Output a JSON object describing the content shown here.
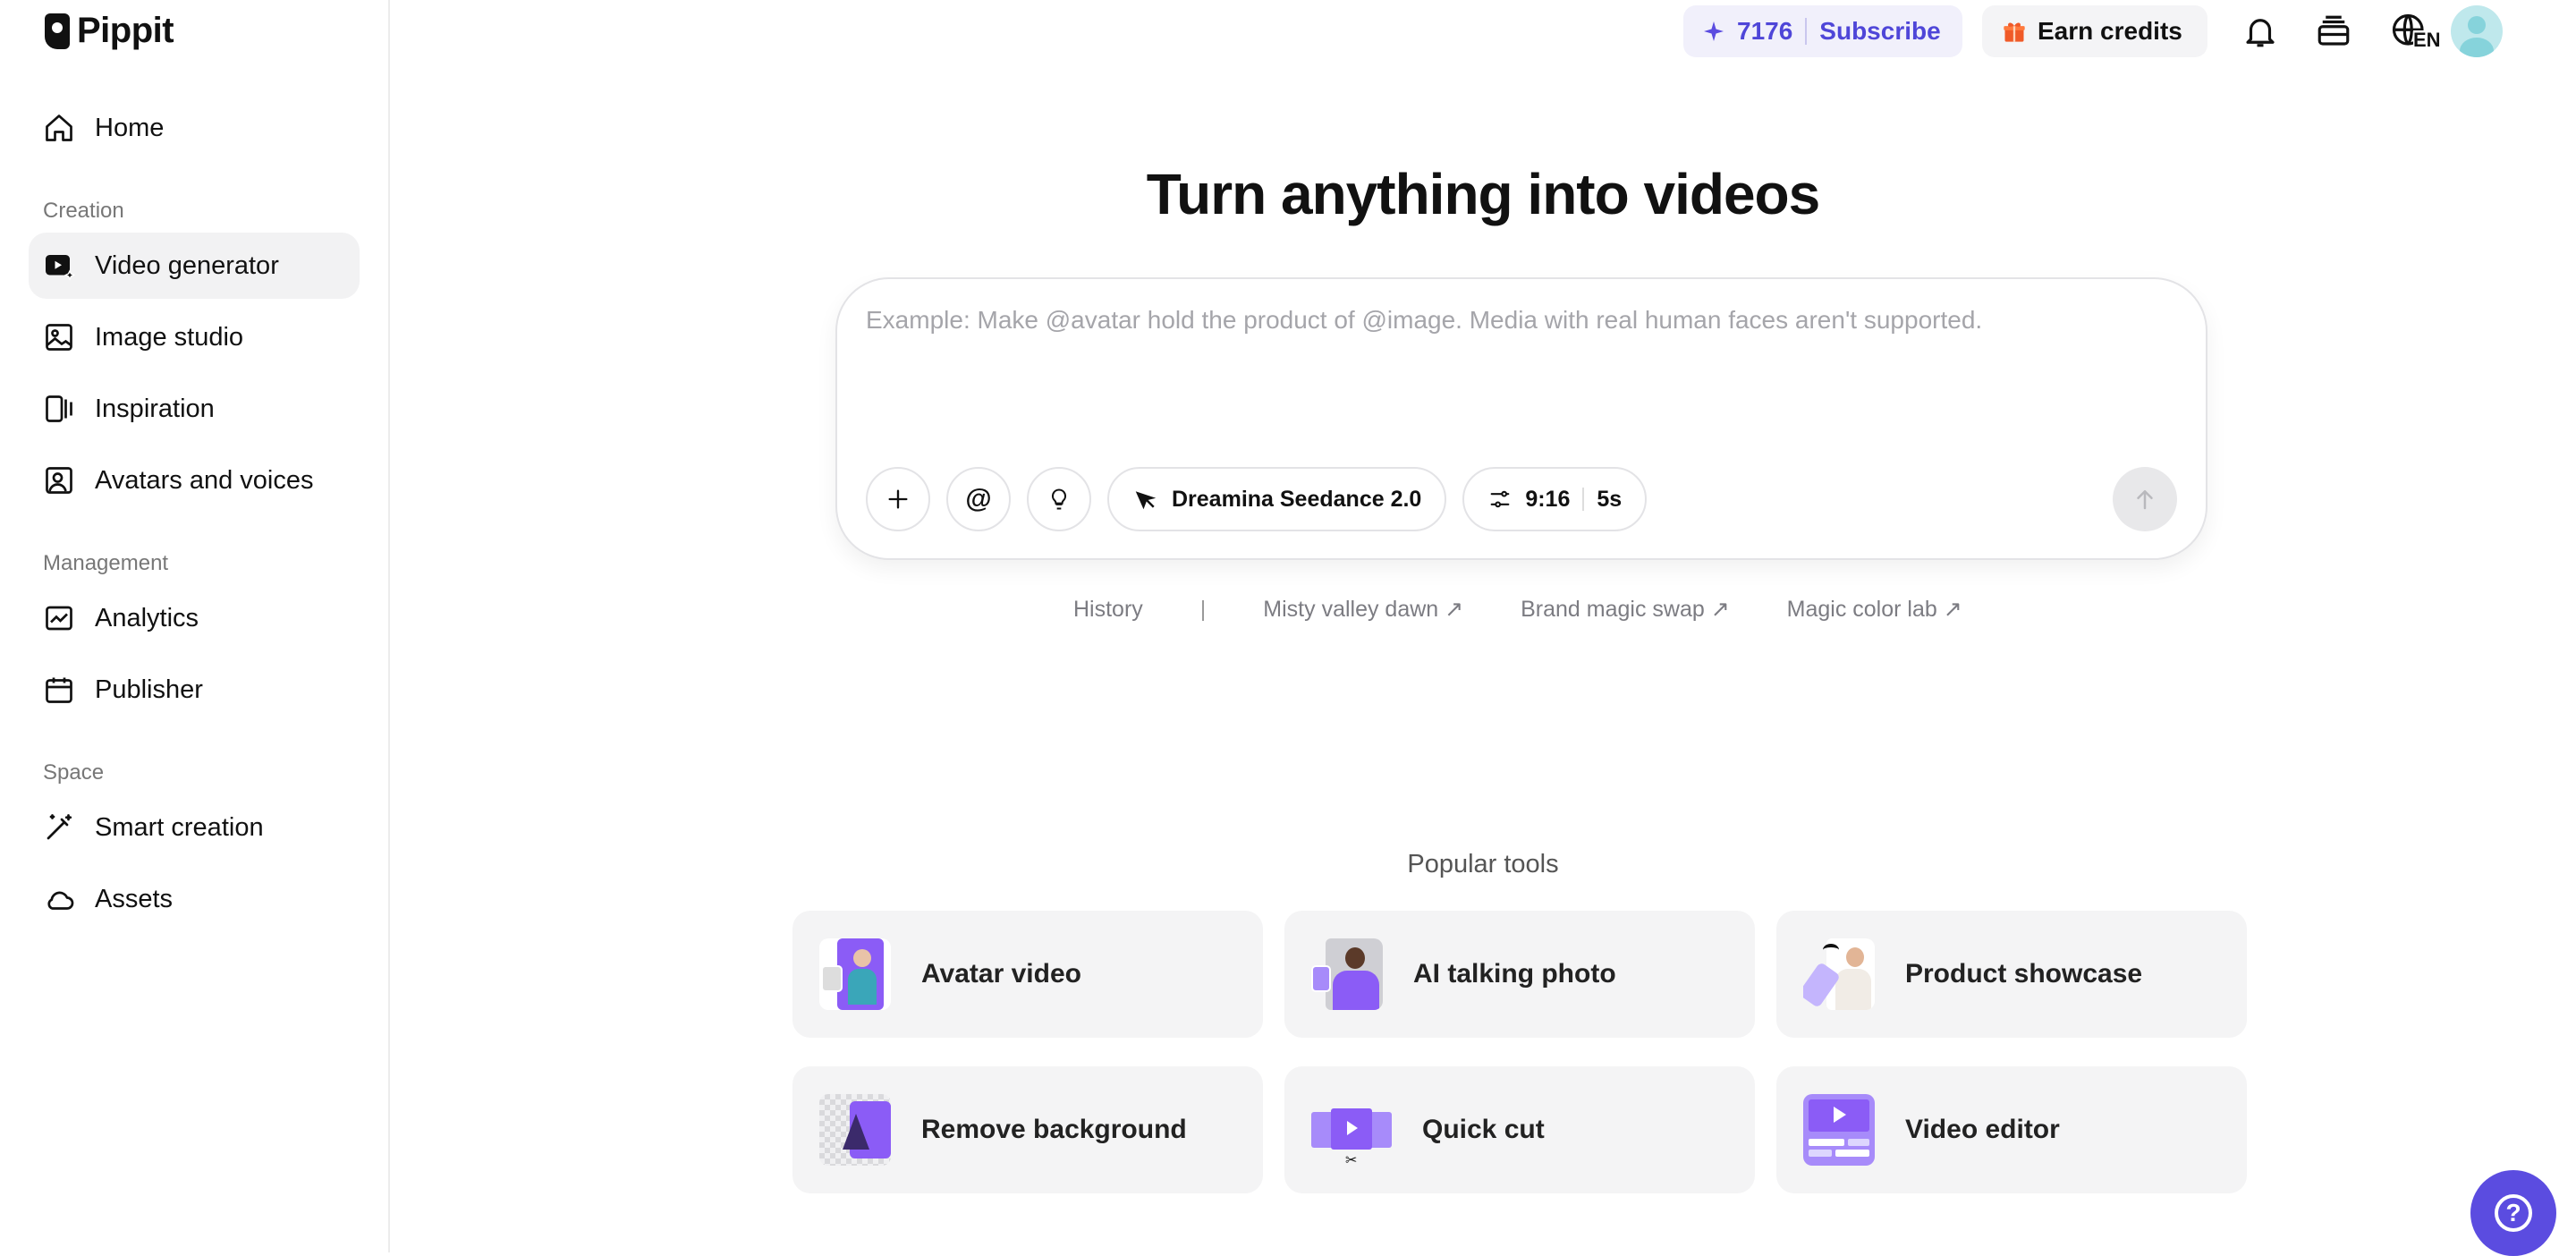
{
  "app": {
    "name": "Pippit"
  },
  "sidebar": {
    "home_label": "Home",
    "sections": [
      {
        "label": "Creation",
        "items": [
          {
            "label": "Video generator",
            "icon": "video-generator-icon",
            "active": true
          },
          {
            "label": "Image studio",
            "icon": "image-studio-icon"
          },
          {
            "label": "Inspiration",
            "icon": "inspiration-icon"
          },
          {
            "label": "Avatars and voices",
            "icon": "avatar-voice-icon"
          }
        ]
      },
      {
        "label": "Management",
        "items": [
          {
            "label": "Analytics",
            "icon": "analytics-icon"
          },
          {
            "label": "Publisher",
            "icon": "calendar-icon"
          }
        ]
      },
      {
        "label": "Space",
        "items": [
          {
            "label": "Smart creation",
            "icon": "magic-wand-icon"
          },
          {
            "label": "Assets",
            "icon": "cloud-icon"
          }
        ]
      }
    ]
  },
  "topbar": {
    "credits": "7176",
    "subscribe_label": "Subscribe",
    "earn_label": "Earn credits",
    "language": "EN",
    "accent_color": "#4f46d8"
  },
  "main": {
    "title": "Turn anything into videos",
    "prompt_placeholder": "Example: Make @avatar hold the product of @image. Media with real human faces aren't supported.",
    "model_label": "Dreamina Seedance 2.0",
    "aspect_ratio": "9:16",
    "duration": "5s",
    "suggestions": {
      "history": "History",
      "divider": "|",
      "items": [
        "Misty valley dawn ↗",
        "Brand magic swap ↗",
        "Magic color lab ↗"
      ]
    },
    "popular_title": "Popular tools",
    "tools": [
      {
        "label": "Avatar video"
      },
      {
        "label": "AI talking photo"
      },
      {
        "label": "Product showcase"
      },
      {
        "label": "Remove background"
      },
      {
        "label": "Quick cut"
      },
      {
        "label": "Video editor"
      }
    ]
  }
}
